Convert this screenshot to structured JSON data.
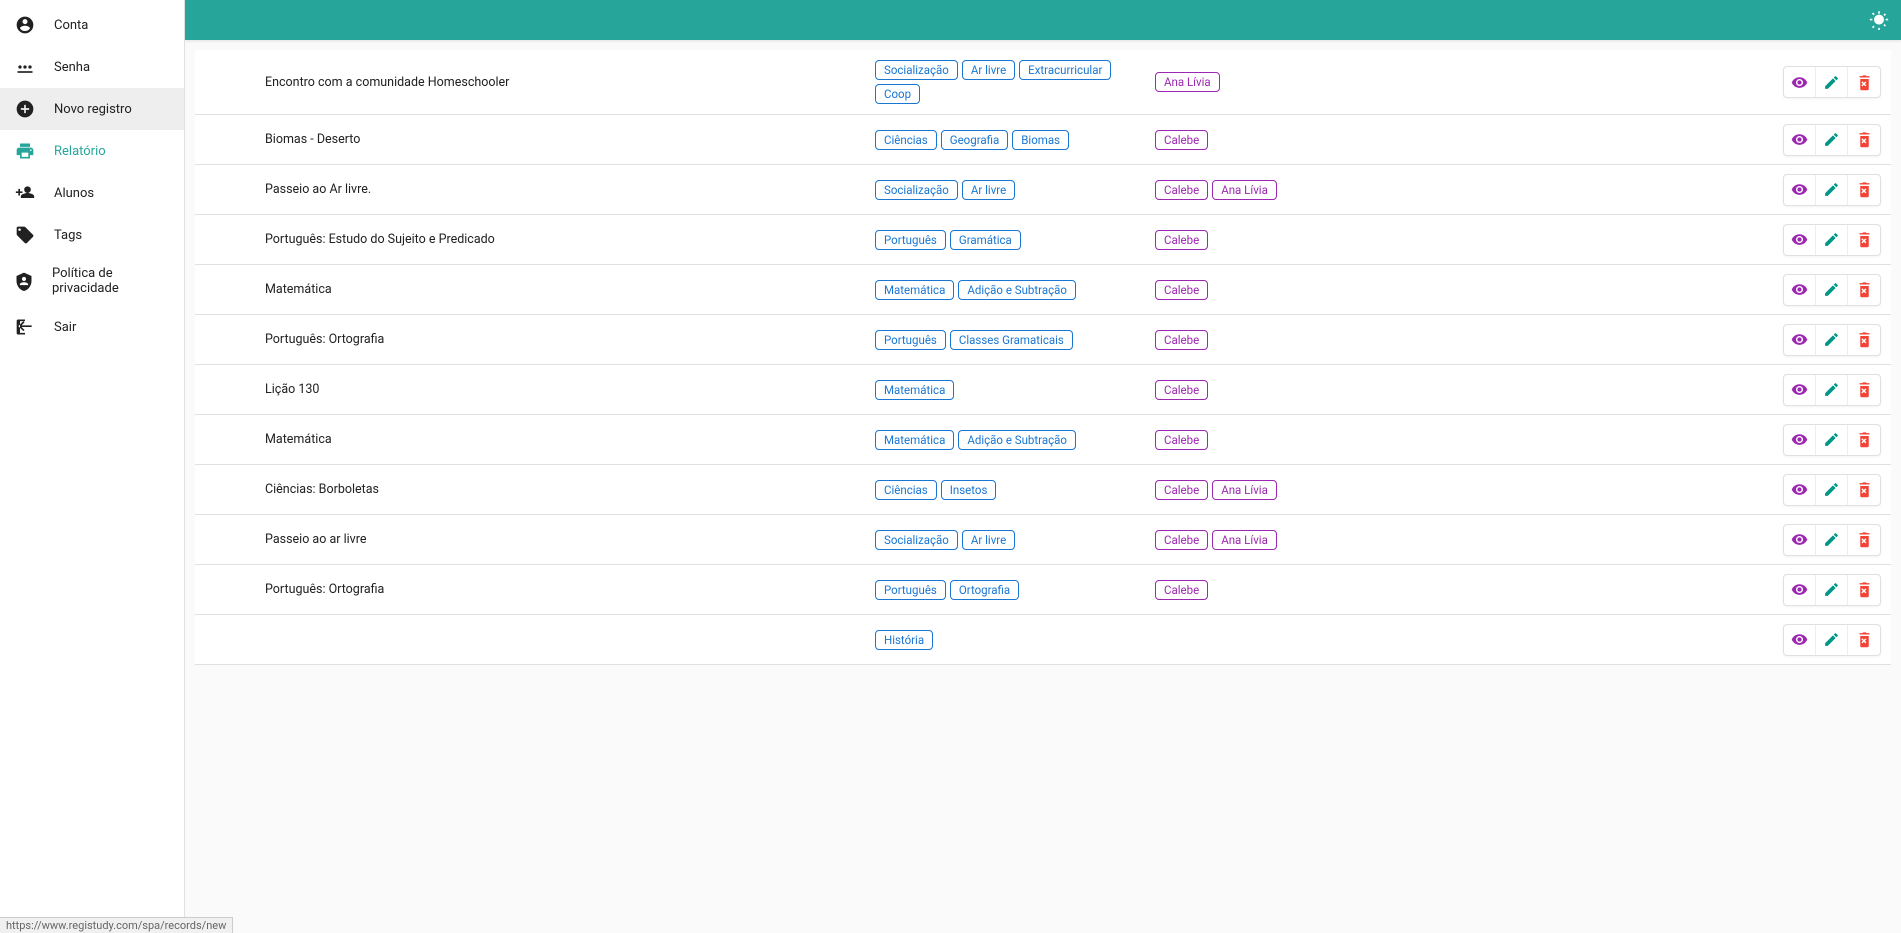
{
  "sidebar": {
    "items": [
      {
        "label": "Conta",
        "icon": "account"
      },
      {
        "label": "Senha",
        "icon": "password"
      },
      {
        "label": "Novo registro",
        "icon": "add-circle",
        "highlight": true
      },
      {
        "label": "Relatório",
        "icon": "print",
        "active": true
      },
      {
        "label": "Alunos",
        "icon": "person-add"
      },
      {
        "label": "Tags",
        "icon": "tag"
      },
      {
        "label": "Política de privacidade",
        "icon": "privacy"
      },
      {
        "label": "Sair",
        "icon": "logout"
      }
    ]
  },
  "records": [
    {
      "title": "Encontro com a comunidade Homeschooler",
      "tags": [
        "Socialização",
        "Ar livre",
        "Extracurricular",
        "Coop"
      ],
      "students": [
        "Ana Lívia"
      ]
    },
    {
      "title": "Biomas - Deserto",
      "tags": [
        "Ciências",
        "Geografia",
        "Biomas"
      ],
      "students": [
        "Calebe"
      ]
    },
    {
      "title": "Passeio ao Ar livre.",
      "tags": [
        "Socialização",
        "Ar livre"
      ],
      "students": [
        "Calebe",
        "Ana Lívia"
      ]
    },
    {
      "title": "Português: Estudo do Sujeito e Predicado",
      "tags": [
        "Português",
        "Gramática"
      ],
      "students": [
        "Calebe"
      ]
    },
    {
      "title": "Matemática",
      "tags": [
        "Matemática",
        "Adição e Subtração"
      ],
      "students": [
        "Calebe"
      ]
    },
    {
      "title": "Português: Ortografia",
      "tags": [
        "Português",
        "Classes Gramaticais"
      ],
      "students": [
        "Calebe"
      ]
    },
    {
      "title": "Lição 130",
      "tags": [
        "Matemática"
      ],
      "students": [
        "Calebe"
      ]
    },
    {
      "title": "Matemática",
      "tags": [
        "Matemática",
        "Adição e Subtração"
      ],
      "students": [
        "Calebe"
      ]
    },
    {
      "title": "Ciências: Borboletas",
      "tags": [
        "Ciências",
        "Insetos"
      ],
      "students": [
        "Calebe",
        "Ana Lívia"
      ]
    },
    {
      "title": "Passeio ao ar livre",
      "tags": [
        "Socialização",
        "Ar livre"
      ],
      "students": [
        "Calebe",
        "Ana Lívia"
      ]
    },
    {
      "title": "Português: Ortografia",
      "tags": [
        "Português",
        "Ortografia"
      ],
      "students": [
        "Calebe"
      ]
    },
    {
      "title": "",
      "tags": [
        "História"
      ],
      "students": []
    }
  ],
  "status_url": "https://www.registudy.com/spa/records/new"
}
